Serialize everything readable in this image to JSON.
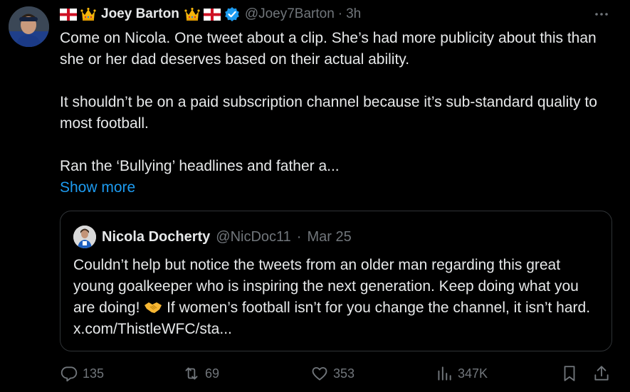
{
  "author": {
    "name": "Joey Barton",
    "handle": "@Joey7Barton",
    "time": "3h",
    "more_icon": "more-icon"
  },
  "tweet": {
    "paragraphs": [
      "Come on Nicola. One tweet about a clip. She’s had more publicity about this than she or her dad deserves based on their actual ability.",
      "It shouldn’t be on a paid subscription channel because it’s sub-standard quality to most football.",
      "Ran the ‘Bullying’ headlines and father a..."
    ],
    "show_more": "Show more"
  },
  "quoted": {
    "name": "Nicola Docherty",
    "handle": "@NicDoc11",
    "time": "Mar 25",
    "text_before": "Couldn’t help but notice the tweets from an older man regarding this great young goalkeeper who is inspiring the next generation. Keep doing what you are doing!",
    "text_after": "If women’s football isn’t for you change the channel, it isn’t hard. x.com/ThistleWFC/sta..."
  },
  "actions": {
    "replies": "135",
    "reposts": "69",
    "likes": "353",
    "views": "347K"
  },
  "colors": {
    "background": "#000000",
    "text": "#e7e9ea",
    "muted": "#71767b",
    "link": "#1d9bf0",
    "border": "#2f3336"
  }
}
